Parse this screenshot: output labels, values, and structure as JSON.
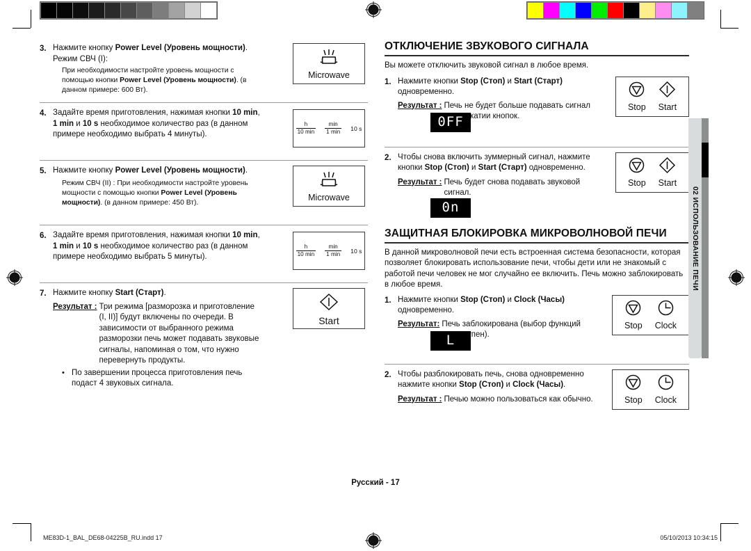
{
  "print_marks": {
    "grayscale_steps": [
      "#000000",
      "#060606",
      "#0d0d0d",
      "#1c1c1c",
      "#2b2b2b",
      "#474747",
      "#5e5e5e",
      "#7d7d7d",
      "#a3a3a3",
      "#d2d2d2",
      "#ffffff"
    ],
    "color_steps": [
      "#ffff00",
      "#ff00ff",
      "#00ffff",
      "#0000ff",
      "#00ee00",
      "#ff0000",
      "#000000",
      "#ffef8c",
      "#ff8cf0",
      "#8cf3ff",
      "#808080"
    ],
    "registration_icon": "registration-target-icon"
  },
  "left_column": {
    "steps": [
      {
        "num": "3.",
        "lines": [
          {
            "type": "main",
            "html": "Нажмите кнопку <b>Power Level (Уровень мощности)</b>."
          },
          {
            "type": "main",
            "html": "Режим СВЧ (I):"
          },
          {
            "type": "sub",
            "html": "При необходимости настройте уровень мощности с помощью кнопки <b>Power Level (Уровень мощности)</b>. (в данном примере: 600 Вт)."
          }
        ],
        "key": {
          "kind": "microwave",
          "label": "Microwave",
          "icon": "microwave-icon"
        }
      },
      {
        "num": "4.",
        "lines": [
          {
            "type": "main",
            "html": "Задайте время приготовления, нажимая кнопки <b>10 min</b>, <b>1 min</b> и <b>10 s</b> необходимое количество раз (в данном примере необходимо выбрать 4 минуты)."
          }
        ],
        "key": {
          "kind": "time",
          "frac1_num": "h",
          "frac1_den": "10 min",
          "frac2_num": "min",
          "frac2_den": "1 min",
          "tens": "10 s"
        }
      },
      {
        "num": "5.",
        "lines": [
          {
            "type": "main",
            "html": "Нажмите кнопку <b>Power Level (Уровень мощности)</b>."
          },
          {
            "type": "sub",
            "html": "Режим СВЧ (II) : При необходимости настройте уровень мощности с помощью кнопки <b>Power Level (Уровень мощности)</b>. (в данном примере: 450 Вт)."
          }
        ],
        "key": {
          "kind": "microwave",
          "label": "Microwave",
          "icon": "microwave-icon"
        }
      },
      {
        "num": "6.",
        "lines": [
          {
            "type": "main",
            "html": "Задайте время приготовления, нажимая кнопки <b>10 min</b>, <b>1 min</b> и <b>10 s</b> необходимое количество раз (в данном примере необходимо выбрать 5 минуты)."
          }
        ],
        "key": {
          "kind": "time",
          "frac1_num": "h",
          "frac1_den": "10 min",
          "frac2_num": "min",
          "frac2_den": "1 min",
          "tens": "10 s"
        }
      },
      {
        "num": "7.",
        "lines": [
          {
            "type": "main",
            "html": "Нажмите кнопку <b>Start (Старт)</b>."
          }
        ],
        "result_label": "Результат :",
        "result_text": "Три режима [разморозка и приготовление (I, II)] будут включены по очереди. В зависимости от выбранного режима разморозки печь может подавать звуковые сигналы, напоминая о том, что нужно перевернуть продукты.",
        "bullet": "По завершении процесса приготовления печь подаст 4 звуковых сигнала.",
        "key": {
          "kind": "start",
          "label": "Start",
          "icon": "start-icon"
        }
      }
    ]
  },
  "right_column": {
    "section1": {
      "heading": "ОТКЛЮЧЕНИЕ ЗВУКОВОГО СИГНАЛА",
      "intro": "Вы можете отключить звуковой сигнал в любое время.",
      "steps": [
        {
          "num": "1.",
          "html": "Нажмите кнопки <b>Stop (Стоп)</b> и <b>Start (Старт)</b> одновременно.",
          "result_label": "Результат :",
          "result_text": "Печь не будет больше подавать сигнал при нажатии кнопок.",
          "led": "0FF",
          "keys": [
            {
              "icon": "stop-icon",
              "label": "Stop"
            },
            {
              "icon": "start-icon",
              "label": "Start"
            }
          ]
        },
        {
          "num": "2.",
          "html": "Чтобы снова включить зуммерный сигнал, нажмите кнопки <b>Stop (Стоп)</b> и <b>Start (Старт)</b> одновременно.",
          "result_label": "Результат :",
          "result_text": "Печь будет снова подавать звуковой сигнал.",
          "led": "0n",
          "keys": [
            {
              "icon": "stop-icon",
              "label": "Stop"
            },
            {
              "icon": "start-icon",
              "label": "Start"
            }
          ]
        }
      ]
    },
    "section2": {
      "heading": "ЗАЩИТНАЯ БЛОКИРОВКА МИКРОВОЛНОВОЙ ПЕЧИ",
      "para": "В данной микроволновой печи есть встроенная система безопасности, которая позволяет блокировать использование печи, чтобы дети или не знакомый с работой печи человек не мог случайно ее включить. Печь можно заблокировать в любое время.",
      "steps": [
        {
          "num": "1.",
          "html": "Нажмите кнопки <b>Stop (Стоп)</b> и <b>Clock (Часы)</b> одновременно.",
          "result_label": "Результат:",
          "result_text": "Печь заблокирована (выбор функций недоступен).",
          "led": "L",
          "keys": [
            {
              "icon": "stop-icon",
              "label": "Stop"
            },
            {
              "icon": "clock-icon",
              "label": "Clock"
            }
          ]
        },
        {
          "num": "2.",
          "html": "Чтобы разблокировать печь, снова одновременно нажмите кнопки <b>Stop (Стоп)</b> и <b>Clock (Часы)</b>.",
          "result_label": "Результат :",
          "result_text": "Печью можно пользоваться как обычно.",
          "led": null,
          "keys": [
            {
              "icon": "stop-icon",
              "label": "Stop"
            },
            {
              "icon": "clock-icon",
              "label": "Clock"
            }
          ]
        }
      ]
    }
  },
  "side_tab": {
    "text": "02  ИСПОЛЬЗОВАНИЕ ПЕЧИ"
  },
  "footer": {
    "page_label": "Русский - 17",
    "file_name": "ME83D-1_BAL_DE68-04225B_RU.indd   17",
    "timestamp": "05/10/2013   10:34:15"
  }
}
